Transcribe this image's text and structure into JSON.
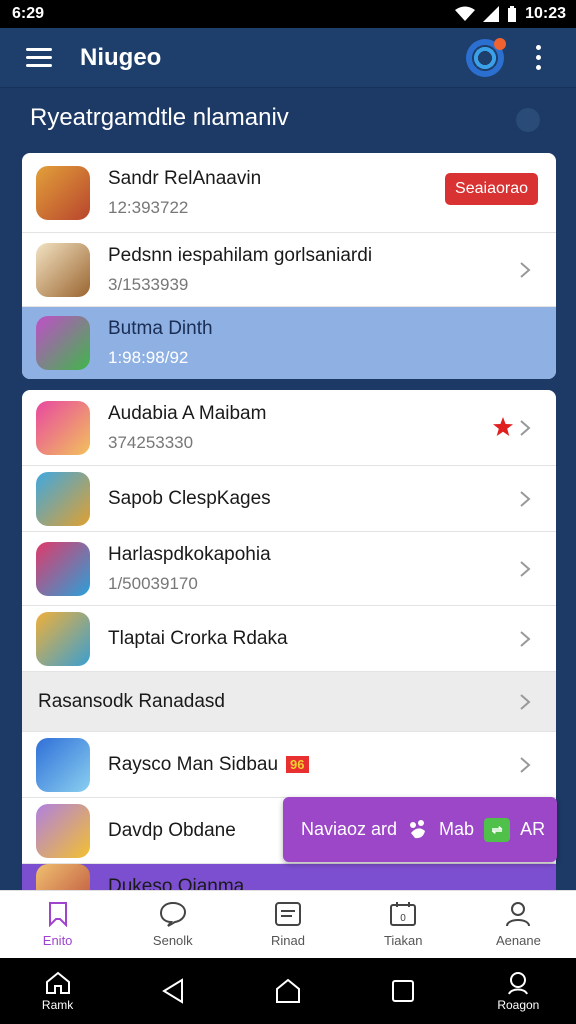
{
  "status_bar": {
    "time_left": "6:29",
    "time_right": "10:23"
  },
  "app_bar": {
    "title": "Niugeo"
  },
  "section": {
    "heading": "Ryeatrgamdtle nlamaniv"
  },
  "card1": [
    {
      "title": "Sandr RelAnaavin",
      "subtitle": "12:393722",
      "badge": "Seaiaorao",
      "icon": "fruit-character-icon"
    },
    {
      "title": "Pedsnn iespahilam gorlsaniardi",
      "subtitle": "3/1533939",
      "icon": "wooden-log-icon"
    },
    {
      "title": "Butma Dinth",
      "subtitle": "1:98:98/92",
      "icon": "green-bird-icon",
      "selected": true
    }
  ],
  "card2": [
    {
      "title": "Audabia A Maibam",
      "subtitle": "374253330",
      "icon": "girl-avatar-icon",
      "starred": true
    },
    {
      "title": "Sapob ClespKages",
      "subtitle": "",
      "icon": "warrior-avatar-icon"
    },
    {
      "title": "Harlaspdkokapohia",
      "subtitle": "1/50039170",
      "icon": "capped-hero-icon"
    },
    {
      "title": "Tlaptai Crorka Rdaka",
      "subtitle": "",
      "icon": "tiki-character-icon"
    },
    {
      "title": "Rasansodk Ranadasd",
      "subtitle": "",
      "icon": "",
      "grey": true
    },
    {
      "title": "Raysco Man Sidbau",
      "subtitle": "",
      "icon": "robot-shield-icon",
      "flag": "96"
    },
    {
      "title": "Davdp Obdane",
      "subtitle": "",
      "icon": "sun-character-icon"
    },
    {
      "title": "Dukeso Oianma",
      "subtitle": "",
      "icon": "bearded-avatar-icon",
      "purple": true
    }
  ],
  "fab": {
    "label": "Naviaoz ard",
    "extra": "Mab",
    "suffix": "AR"
  },
  "bottom_nav": [
    {
      "label": "Enito",
      "icon": "bookmark-icon",
      "active": true
    },
    {
      "label": "Senolk",
      "icon": "chat-bubble-icon"
    },
    {
      "label": "Rinad",
      "icon": "document-icon"
    },
    {
      "label": "Tiakan",
      "icon": "calendar-icon"
    },
    {
      "label": "Aenane",
      "icon": "person-icon"
    }
  ],
  "system_nav": [
    {
      "label": "Ramk",
      "icon": "home-outline-icon"
    },
    {
      "label": "",
      "icon": "back-triangle-icon"
    },
    {
      "label": "",
      "icon": "home-pentagon-icon"
    },
    {
      "label": "",
      "icon": "recents-square-icon"
    },
    {
      "label": "Roagon",
      "icon": "search-person-icon"
    }
  ],
  "colors": {
    "background": "#1d3a66",
    "appbar": "#1e3e6c",
    "selected_row": "#8eb0e2",
    "badge": "#d93232",
    "fab": "#9c46c8",
    "active_nav": "#a044d0"
  }
}
